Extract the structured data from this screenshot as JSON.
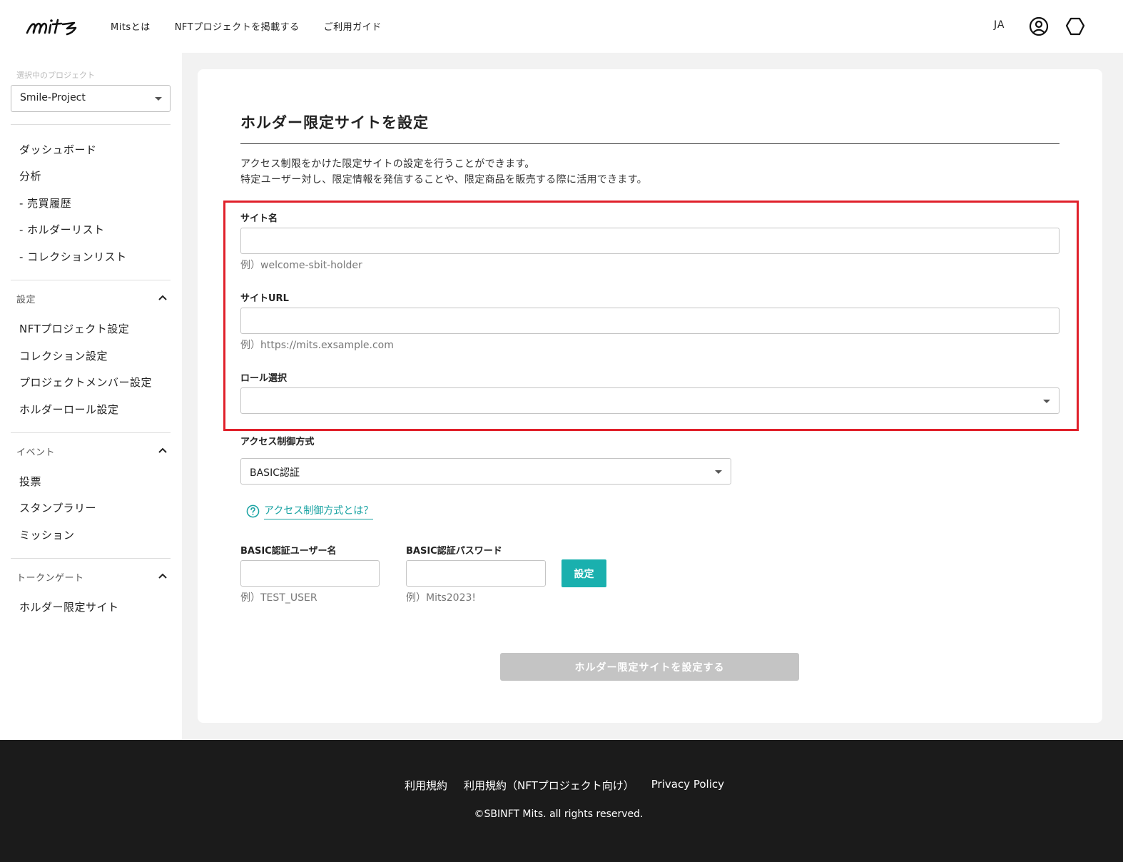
{
  "header": {
    "logo_text": "mits",
    "nav": [
      "Mitsとは",
      "NFTプロジェクトを掲載する",
      "ご利用ガイド"
    ],
    "lang": "JA"
  },
  "sidebar": {
    "caption": "選択中のプロジェクト",
    "project": "Smile-Project",
    "items_main": [
      "ダッシュボード",
      "分析",
      "- 売買履歴",
      "- ホルダーリスト",
      "- コレクションリスト"
    ],
    "section_settings": "設定",
    "items_settings": [
      "NFTプロジェクト設定",
      "コレクション設定",
      "プロジェクトメンバー設定",
      "ホルダーロール設定"
    ],
    "section_event": "イベント",
    "items_event": [
      "投票",
      "スタンプラリー",
      "ミッション"
    ],
    "section_token": "トークンゲート",
    "items_token": [
      "ホルダー限定サイト"
    ]
  },
  "main": {
    "title": "ホルダー限定サイトを設定",
    "desc1": "アクセス制限をかけた限定サイトの設定を行うことができます。",
    "desc2": "特定ユーザー対し、限定情報を発信することや、限定商品を販売する際に活用できます。",
    "site_name_label": "サイト名",
    "site_name_value": "",
    "site_name_hint": "例）welcome-sbit-holder",
    "site_url_label": "サイトURL",
    "site_url_value": "",
    "site_url_hint": "例）https://mits.exsample.com",
    "role_label": "ロール選択",
    "role_value": "",
    "access_label": "アクセス制御方式",
    "access_value": "BASIC認証",
    "help_text": "アクセス制御方式とは？",
    "basic_user_label": "BASIC認証ユーザー名",
    "basic_user_value": "",
    "basic_user_hint": "例）TEST_USER",
    "basic_pass_label": "BASIC認証パスワード",
    "basic_pass_value": "",
    "basic_pass_hint": "例）Mits2023!",
    "set_button": "設定",
    "submit_button": "ホルダー限定サイトを設定する"
  },
  "footer": {
    "links": [
      "利用規約",
      "利用規約（NFTプロジェクト向け）",
      "Privacy Policy"
    ],
    "copyright": "©SBINFT Mits. all rights reserved."
  },
  "colors": {
    "accent": "#1ab0ae",
    "highlight": "#e0202a",
    "footer_bg": "#1b1b1b",
    "disabled": "#c4c4c4"
  }
}
